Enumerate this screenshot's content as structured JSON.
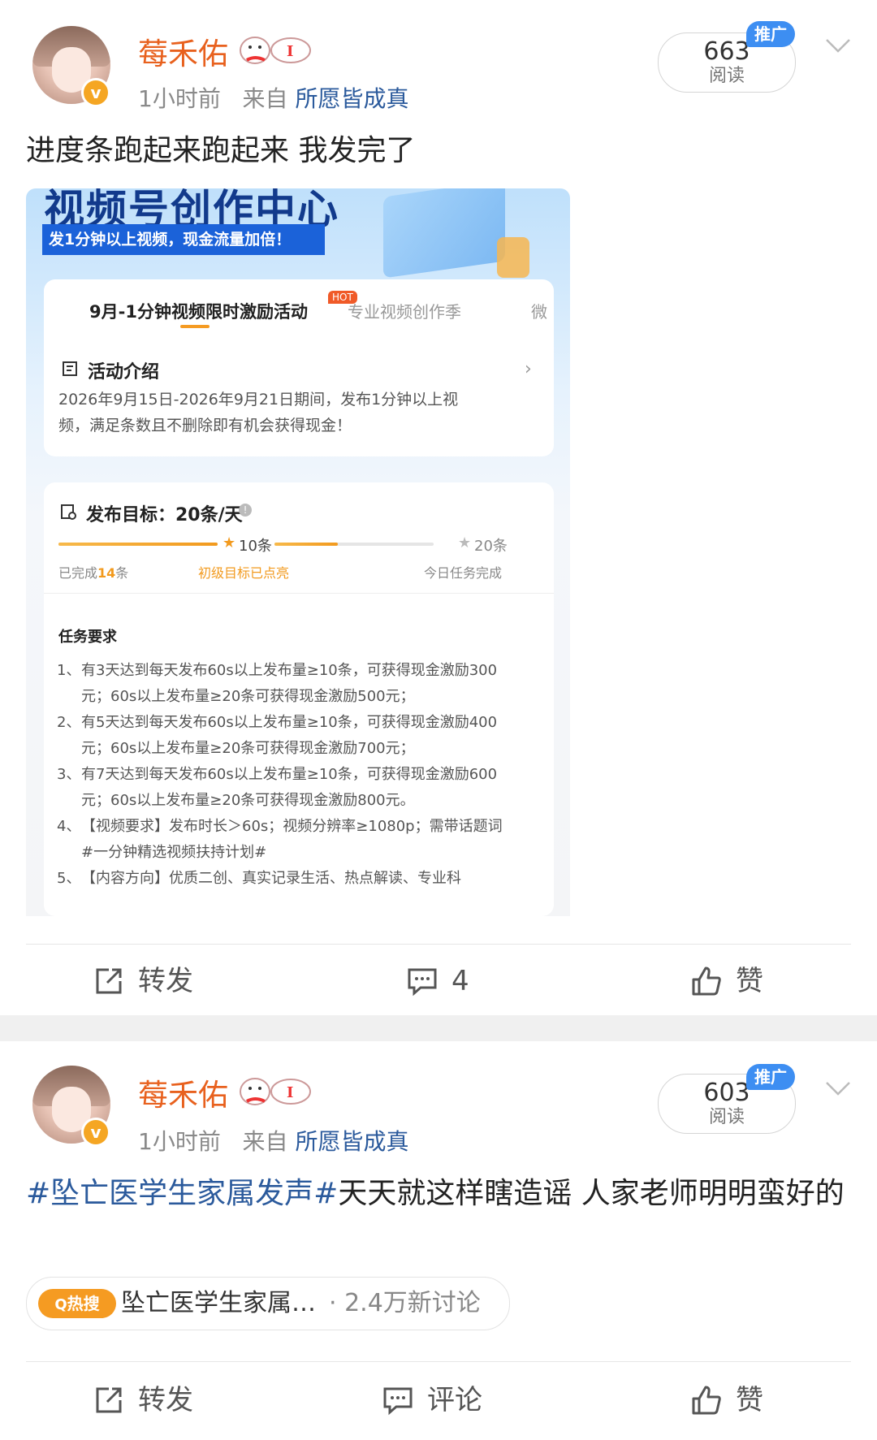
{
  "colors": {
    "username": "#e8611e",
    "link": "#2b5a9c",
    "promo": "#3d8ef2",
    "hot": "#f59b22"
  },
  "posts": [
    {
      "username": "莓禾佑",
      "time": "1小时前",
      "from_prefix": "来自",
      "source": "所愿皆成真",
      "reads": "663",
      "reads_label": "阅读",
      "promo_tag": "推广",
      "text": "进度条跑起来跑起来 我发完了",
      "actions": {
        "repost": "转发",
        "comment": "4",
        "like": "赞"
      }
    },
    {
      "username": "莓禾佑",
      "time": "1小时前",
      "from_prefix": "来自",
      "source": "所愿皆成真",
      "reads": "603",
      "reads_label": "阅读",
      "promo_tag": "推广",
      "hashtag": "#坠亡医学生家属发声#",
      "text": "天天就这样瞎造谣 人家老师明明蛮好的",
      "topic": {
        "badge": "热搜",
        "name": "坠亡医学生家属…",
        "count": "· 2.4万新讨论"
      },
      "actions": {
        "repost": "转发",
        "comment": "评论",
        "like": "赞"
      }
    }
  ],
  "screenshot": {
    "header_title": "视频号创作中心",
    "banner": "发1分钟以上视频，现金流量加倍！",
    "tab_active": "9月-1分钟视频限时激励活动",
    "hot_tag": "HOT",
    "tab_other": "专业视频创作季",
    "tab_cut": "微",
    "intro_title": "活动介绍",
    "intro_body": "2026年9月15日-2026年9月21日期间，发布1分钟以上视频，满足条数且不删除即有机会获得现金！",
    "goal_title": "发布目标：20条/天",
    "progress": {
      "completed": 14,
      "target": 20,
      "milestone_1": 10
    },
    "milestone_1_label": "10条",
    "milestone_2_label": "20条",
    "done_prefix": "已完成",
    "done_count": "14",
    "done_suffix": "条",
    "level1_text": "初级目标已点亮",
    "today_text": "今日任务完成",
    "task_title": "任务要求",
    "tasks": [
      {
        "num": "1、",
        "text": "有3天达到每天发布60s以上发布量≥10条，可获得现金激励300元；60s以上发布量≥20条可获得现金激励500元；"
      },
      {
        "num": "2、",
        "text": "有5天达到每天发布60s以上发布量≥10条，可获得现金激励400元；60s以上发布量≥20条可获得现金激励700元；"
      },
      {
        "num": "3、",
        "text": "有7天达到每天发布60s以上发布量≥10条，可获得现金激励600元；60s以上发布量≥20条可获得现金激励800元。"
      },
      {
        "num": "4、",
        "text": "【视频要求】发布时长＞60s；视频分辨率≥1080p；需带话题词#一分钟精选视频扶持计划#"
      },
      {
        "num": "5、",
        "text": "【内容方向】优质二创、真实记录生活、热点解读、专业科"
      }
    ]
  }
}
